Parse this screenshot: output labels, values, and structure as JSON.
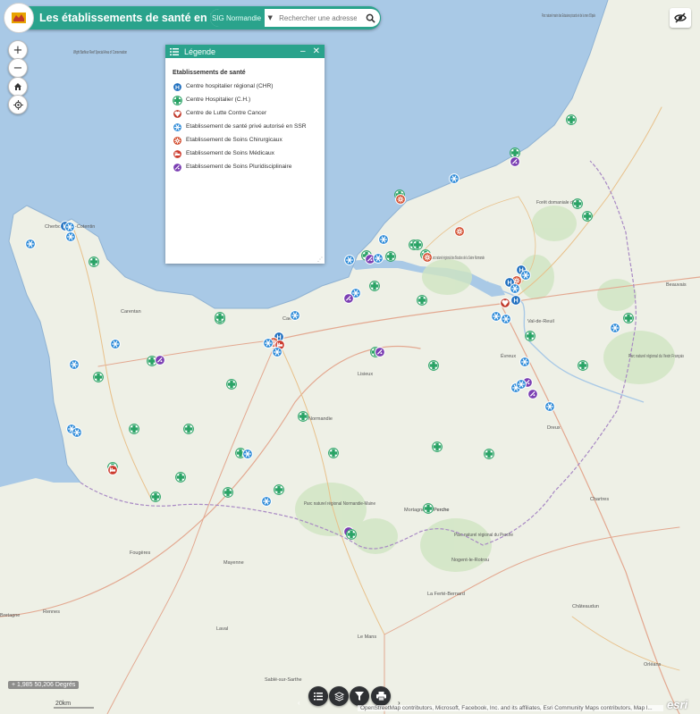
{
  "header": {
    "title": "Les établissements de santé en Normandie",
    "search_source": "SIG Normandie",
    "search_placeholder": "Rechercher une adresse ou un"
  },
  "legend": {
    "title": "Légende",
    "section": "Etablissements de santé",
    "items": [
      {
        "label": "Centre hospitalier régional (CHR)",
        "icon": "hospital-h-icon",
        "color": "#1f6fbf"
      },
      {
        "label": "Centre Hospitalier (C.H.)",
        "icon": "green-cross-icon",
        "color": "#2aa366"
      },
      {
        "label": "Centre de Lutte Contre Cancer",
        "icon": "heart-ribbon-icon",
        "color": "#c0392b"
      },
      {
        "label": "Etablissement de santé privé autorisé en SSR",
        "icon": "blue-snowflake-icon",
        "color": "#2e8bd8"
      },
      {
        "label": "Etablissement de Soins Chirurgicaux",
        "icon": "surgical-star-icon",
        "color": "#d24a2b"
      },
      {
        "label": "Etablissement de Soins Médicaux",
        "icon": "medical-bed-icon",
        "color": "#cc3b2e"
      },
      {
        "label": "Etablissement de Soins Pluridisciplinaire",
        "icon": "multidisciplinary-icon",
        "color": "#7b3fb3"
      }
    ]
  },
  "map": {
    "labels": {
      "parc_marais": "Parc naturel marin des Estuaires picards et de la mer d'Opale",
      "wight": "Wight Barfleur Reef Special Area of Conservation",
      "cherbourg": "Cherbourg-en-Cotentin",
      "carentan": "Carentan",
      "caen": "Caen",
      "lisieux": "Lisieux",
      "normandie": "Normandie",
      "val_de_reuil": "Val-de-Reuil",
      "parc_seine": "Parc naturel régional des Boucles de la Seine Normande",
      "foret_eu": "Forêt domaniale d'Eu",
      "parc_vexin": "Parc naturel régional du Vexin Français",
      "parc_normandie_maine": "Parc naturel régional Normandie-Maine",
      "parc_perche": "Parc naturel régional du Perche",
      "mortagne": "Mortagne-au-Perche",
      "rennes": "Rennes",
      "laval": "Laval",
      "le_mans": "Le Mans",
      "mayenne": "Mayenne",
      "fougeres": "Fougères",
      "bretagne": "Bretagne",
      "nogent": "Nogent-le-Rotrou",
      "la_ferte": "La Ferté-Bernard",
      "chartres": "Chartres",
      "orleans": "Orléans",
      "perche": "Perche",
      "sable": "Sablé-sur-Sarthe",
      "chateaudun": "Châteaudun",
      "dreux": "Dreux",
      "evreux": "Évreux",
      "beauvais": "Beauvais"
    },
    "scale": "20km"
  },
  "coords": "1,985 50,206 Degrés",
  "attribution": "OpenStreetMap contributors, Microsoft, Facebook, Inc. and its affiliates, Esri Community Maps contributors, Map l...",
  "esri": "esri",
  "colors": {
    "accent": "#2aa38c",
    "chr": "#1f6fbf",
    "ch": "#2aa366",
    "cancer": "#c0392b",
    "ssr": "#2e8bd8",
    "chir": "#d24a2b",
    "med": "#cc3b2e",
    "pluri": "#7b3fb3",
    "sea": "#a7c8e6",
    "land": "#eef0e6"
  }
}
